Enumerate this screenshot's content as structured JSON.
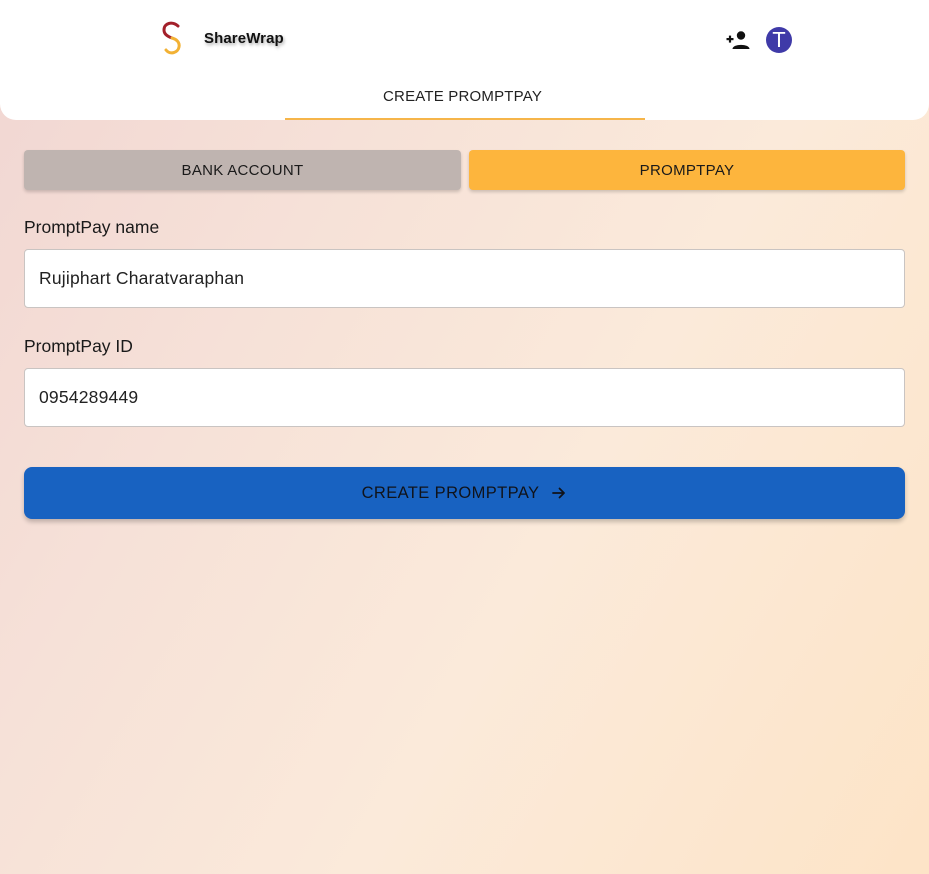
{
  "header": {
    "brand_name": "ShareWrap",
    "avatar_letter": "T",
    "tab_label": "CREATE PROMPTPAY",
    "icons": [
      "sharewrap-logo-icon",
      "person-add-icon"
    ],
    "colors": {
      "tab_underline": "#f6b54a",
      "avatar": "#3f3aa8"
    }
  },
  "segment": {
    "bank_label": "BANK ACCOUNT",
    "promptpay_label": "PROMPTPAY",
    "selected": "PROMPTPAY",
    "colors": {
      "inactive": "#bfb4b0",
      "active": "#fdb53d"
    }
  },
  "form": {
    "name_label": "PromptPay name",
    "name_value": "Rujiphart Charatvaraphan",
    "id_label": "PromptPay ID",
    "id_value": "0954289449"
  },
  "submit": {
    "label": "CREATE PROMPTPAY",
    "icon": "arrow-right-icon",
    "color": "#1862c1"
  }
}
